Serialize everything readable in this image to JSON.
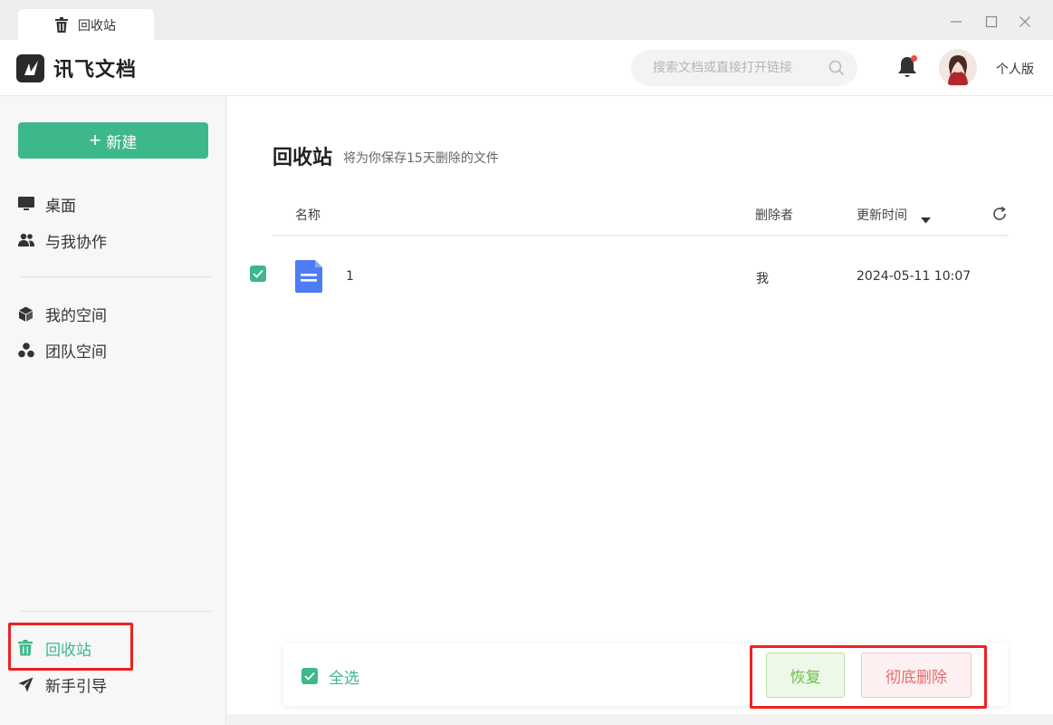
{
  "tab": {
    "label": "回收站",
    "icon": "trash-icon"
  },
  "app": {
    "name": "讯飞文档"
  },
  "search": {
    "placeholder": "搜索文档或直接打开链接"
  },
  "user": {
    "plan": "个人版"
  },
  "sidebar": {
    "new_label": "新建",
    "items": [
      {
        "label": "桌面",
        "icon": "desktop-icon"
      },
      {
        "label": "与我协作",
        "icon": "users-icon"
      },
      {
        "label": "我的空间",
        "icon": "cube-icon"
      },
      {
        "label": "团队空间",
        "icon": "team-icon"
      },
      {
        "label": "回收站",
        "icon": "trash-icon",
        "active": true
      },
      {
        "label": "新手引导",
        "icon": "paper-plane-icon"
      }
    ]
  },
  "main": {
    "title": "回收站",
    "subtitle": "将为你保存15天删除的文件",
    "columns": {
      "name": "名称",
      "deleter": "删除者",
      "updated": "更新时间"
    },
    "rows": [
      {
        "name": "1",
        "deleter": "我",
        "updated": "2024-05-11 10:07",
        "checked": true
      }
    ],
    "select_all": "全选",
    "restore_label": "恢复",
    "delete_label": "彻底删除"
  },
  "colors": {
    "accent": "#3db88b",
    "restore": "#6cc04a",
    "danger": "#e56d6d",
    "highlight": "#f02020"
  }
}
